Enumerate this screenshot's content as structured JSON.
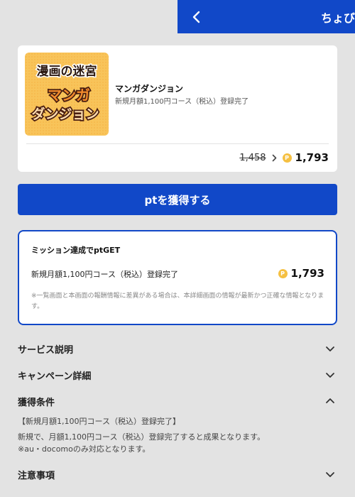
{
  "header": {
    "title": "ちょび"
  },
  "product": {
    "thumbnail": {
      "line1": "漫画の迷宮",
      "line2": "マンガ",
      "line3": "ダンジョン"
    },
    "name": "マンガダンジョン",
    "description": "新規月額1,100円コース（税込）登録完了",
    "old_points": "1,458",
    "new_points": "1,793",
    "coin_symbol": "P"
  },
  "cta": {
    "label": "ptを獲得する"
  },
  "mission": {
    "title": "ミッション達成でptGET",
    "task": "新規月額1,100円コース（税込）登録完了",
    "points": "1,793",
    "coin_symbol": "P",
    "note": "※一覧画面と本画面の報酬情報に差異がある場合は、本詳細画面の情報が最新かつ正確な情報となります。"
  },
  "sections": {
    "service": {
      "label": "サービス説明",
      "expanded": false
    },
    "campaign": {
      "label": "キャンペーン詳細",
      "expanded": false
    },
    "conditions": {
      "label": "獲得条件",
      "expanded": true,
      "heading": "【新規月額1,100円コース（税込）登録完了】",
      "body_line1": "新規で、月額1,100円コース（税込）登録完了すると成果となります。",
      "body_line2": "※au・docomoのみ対応となります。"
    },
    "notes": {
      "label": "注意事項",
      "expanded": false
    }
  },
  "colors": {
    "primary": "#1148c8",
    "background": "#e3e3e3",
    "coin": "#f5c042"
  },
  "icons": {
    "back": "chevron-left-icon",
    "arrow": "chevron-right-icon",
    "expand": "chevron-down-icon",
    "collapse": "chevron-up-icon",
    "coin": "point-coin-icon"
  }
}
